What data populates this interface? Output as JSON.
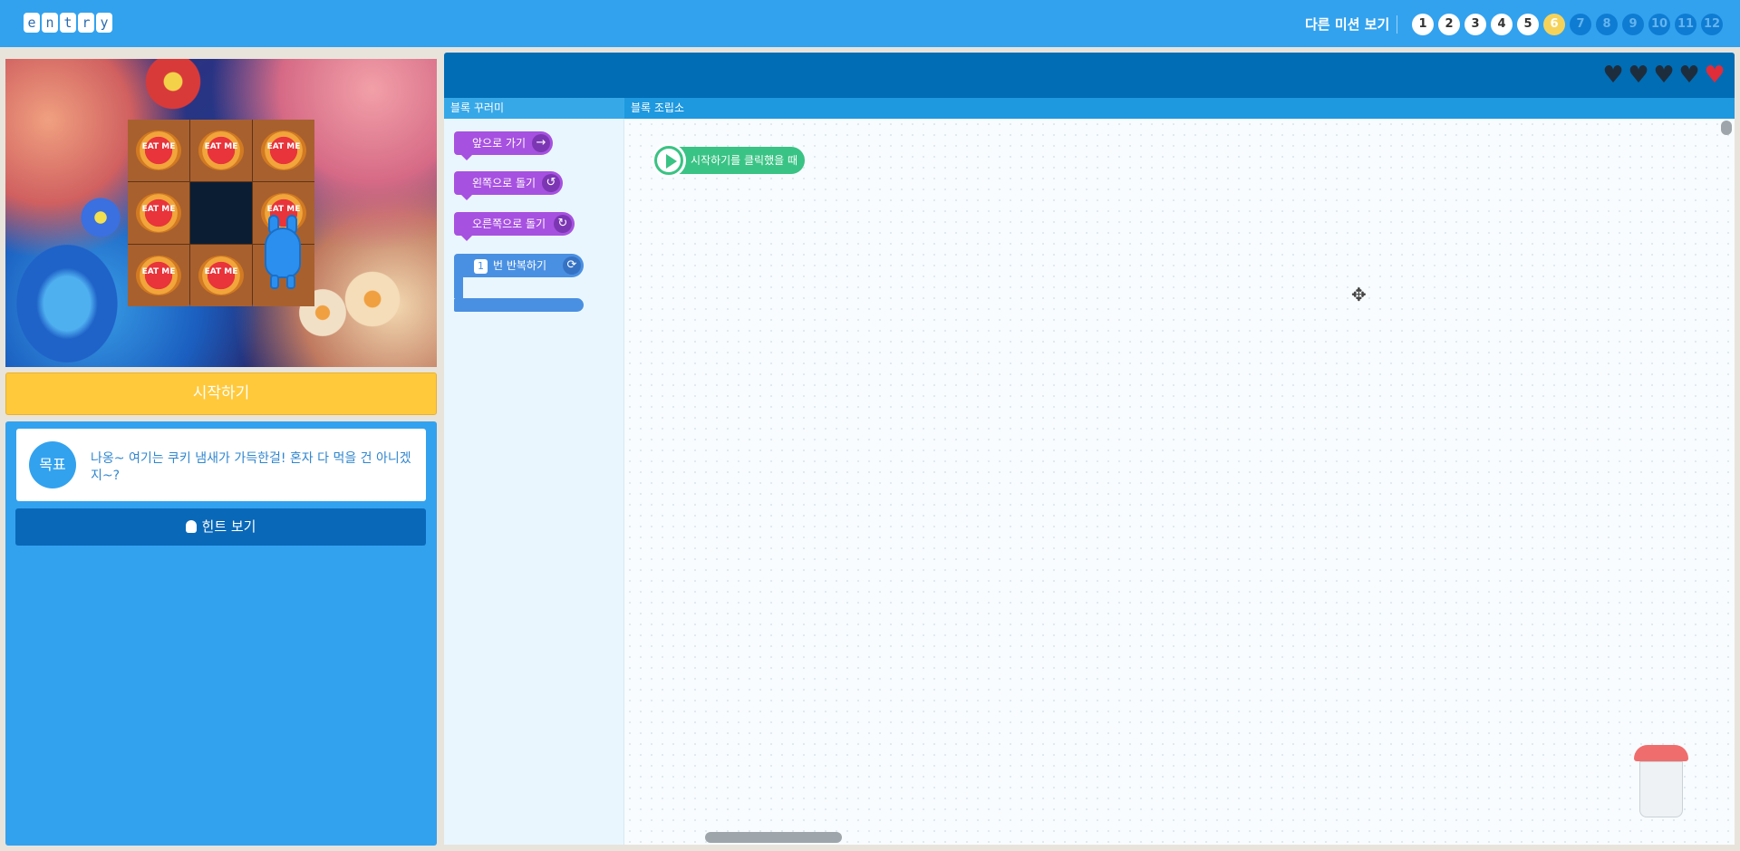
{
  "header": {
    "logo_letters": [
      "e",
      "n",
      "t",
      "r",
      "y"
    ],
    "other_missions_label": "다른 미션 보기",
    "missions": [
      {
        "label": "1",
        "state": "done"
      },
      {
        "label": "2",
        "state": "done"
      },
      {
        "label": "3",
        "state": "done"
      },
      {
        "label": "4",
        "state": "done"
      },
      {
        "label": "5",
        "state": "done"
      },
      {
        "label": "6",
        "state": "current"
      },
      {
        "label": "7",
        "state": "locked"
      },
      {
        "label": "8",
        "state": "locked"
      },
      {
        "label": "9",
        "state": "locked"
      },
      {
        "label": "10",
        "state": "locked"
      },
      {
        "label": "11",
        "state": "locked"
      },
      {
        "label": "12",
        "state": "locked"
      }
    ]
  },
  "stage": {
    "tile_text": "EAT ME",
    "grid": [
      [
        "tart",
        "tart",
        "tart"
      ],
      [
        "tart",
        "empty",
        "tart"
      ],
      [
        "tart",
        "tart",
        "character"
      ]
    ]
  },
  "start_button": "시작하기",
  "goal": {
    "badge": "목표",
    "text": "나옹~ 여기는 쿠키 냄새가 가득한걸! 혼자 다 먹을 건 아니겠지~?"
  },
  "hint_button": "힌트 보기",
  "workspace": {
    "lives": {
      "filled": 1,
      "total": 5
    },
    "palette_tab": "블록 꾸러미",
    "board_tab": "블록 조립소",
    "palette_blocks": {
      "forward": "앞으로 가기",
      "turn_left": "왼쪽으로 돌기",
      "turn_right": "오른쪽으로 돌기",
      "repeat_count": "1",
      "repeat": "번 반복하기"
    },
    "start_block": "시작하기를 클릭했을 때"
  },
  "colors": {
    "header_blue": "#32a2ef",
    "workspace_header": "#006db5",
    "start_yellow": "#ffc93b",
    "block_purple": "#a751e0",
    "block_blue": "#4a90e2",
    "start_green": "#39c384"
  }
}
